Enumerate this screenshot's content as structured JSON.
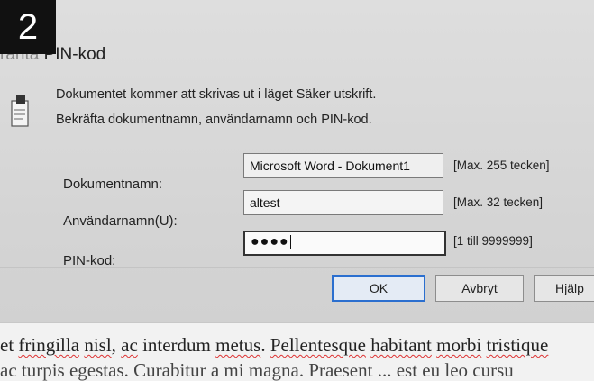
{
  "step_badge": "2",
  "dialog": {
    "title_faded": "ränta ",
    "title": "PIN-kod",
    "message_line1": "Dokumentet kommer att skrivas ut i läget Säker utskrift.",
    "message_line2": "Bekräfta dokumentnamn, användarnamn och PIN-kod.",
    "fields": {
      "document_name": {
        "label": "Dokumentnamn:",
        "value": "Microsoft Word - Dokument1",
        "hint": "[Max. 255 tecken]"
      },
      "user_name": {
        "label": "Användarnamn(U):",
        "value": "altest",
        "hint": "[Max. 32 tecken]"
      },
      "pin": {
        "label": "PIN-kod:",
        "value": "●●●●",
        "hint": "[1 till 9999999]"
      }
    },
    "buttons": {
      "ok": "OK",
      "cancel": "Avbryt",
      "help": "Hjälp"
    }
  },
  "document_background": {
    "line1": {
      "p1": "et ",
      "w1": "fringilla",
      "s1": " ",
      "w2": "nisl",
      "s2": ", ",
      "w3": "ac",
      "s3": " interdum ",
      "w4": "metus",
      "s4": ". ",
      "w5": "Pellentesque",
      "s5": " ",
      "w6": "habitant",
      "s6": " ",
      "w7": "morbi",
      "s7": " ",
      "w8": "tristique"
    },
    "line2": "ac turpis egestas. Curabitur a mi magna. Praesent ... est eu leo cursu"
  },
  "colors": {
    "ok_border": "#2b6fcf",
    "spell_underline": "#d33"
  },
  "icons": {
    "document_icon": "printer-document-icon"
  }
}
